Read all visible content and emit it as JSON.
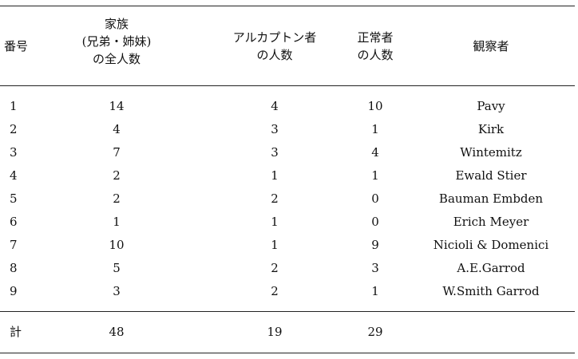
{
  "table": {
    "headers": {
      "number": [
        "番号"
      ],
      "family": [
        "家族",
        "(兄弟・姉妹)",
        "の全人数"
      ],
      "alkaptonuria": [
        "アルカプトン者",
        "の人数"
      ],
      "normal": [
        "正常者",
        "の人数"
      ],
      "observer": [
        "観察者"
      ]
    },
    "rows": [
      {
        "number": "1",
        "family": "14",
        "alkaptonuria": "4",
        "normal": "10",
        "observer": "Pavy"
      },
      {
        "number": "2",
        "family": "4",
        "alkaptonuria": "3",
        "normal": "1",
        "observer": "Kirk"
      },
      {
        "number": "3",
        "family": "7",
        "alkaptonuria": "3",
        "normal": "4",
        "observer": "Wintemitz"
      },
      {
        "number": "4",
        "family": "2",
        "alkaptonuria": "1",
        "normal": "1",
        "observer": "Ewald Stier"
      },
      {
        "number": "5",
        "family": "2",
        "alkaptonuria": "2",
        "normal": "0",
        "observer": "Bauman Embden"
      },
      {
        "number": "6",
        "family": "1",
        "alkaptonuria": "1",
        "normal": "0",
        "observer": "Erich Meyer"
      },
      {
        "number": "7",
        "family": "10",
        "alkaptonuria": "1",
        "normal": "9",
        "observer": "Nicioli & Domenici"
      },
      {
        "number": "8",
        "family": "5",
        "alkaptonuria": "2",
        "normal": "3",
        "observer": "A.E.Garrod"
      },
      {
        "number": "9",
        "family": "3",
        "alkaptonuria": "2",
        "normal": "1",
        "observer": "W.Smith Garrod"
      }
    ],
    "total": {
      "label": "計",
      "family": "48",
      "alkaptonuria": "19",
      "normal": "29"
    }
  }
}
